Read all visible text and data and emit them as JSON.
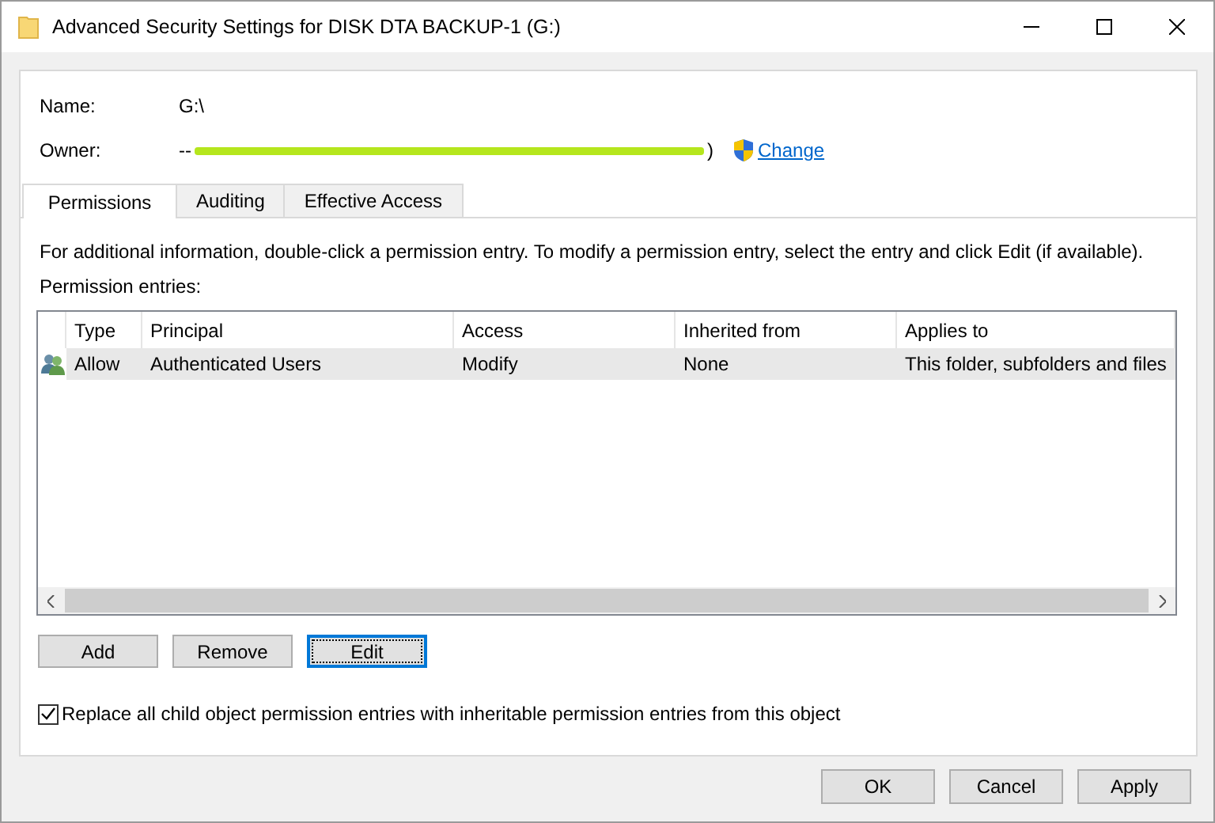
{
  "window": {
    "title": "Advanced Security Settings for DISK DTA BACKUP-1 (G:)"
  },
  "name": {
    "label": "Name:",
    "value": "G:\\"
  },
  "owner": {
    "label": "Owner:",
    "prefix": "--",
    "suffix": ")",
    "link": "Change"
  },
  "tabs": [
    {
      "label": "Permissions",
      "selected": true
    },
    {
      "label": "Auditing",
      "selected": false
    },
    {
      "label": "Effective Access",
      "selected": false
    }
  ],
  "info": "For additional information, double-click a permission entry. To modify a permission entry, select the entry and click Edit (if available).",
  "entries_label": "Permission entries:",
  "table": {
    "columns": [
      "Type",
      "Principal",
      "Access",
      "Inherited from",
      "Applies to"
    ],
    "rows": [
      {
        "cells": [
          "Allow",
          "Authenticated Users",
          "Modify",
          "None",
          "This folder, subfolders and files"
        ],
        "selected": true
      }
    ]
  },
  "entry_buttons": [
    {
      "label": "Add",
      "focused": false
    },
    {
      "label": "Remove",
      "focused": false
    },
    {
      "label": "Edit",
      "focused": true
    }
  ],
  "replace_checkbox": {
    "label": "Replace all child object permission entries with inheritable permission entries from this object",
    "checked": true
  },
  "buttons": [
    "OK",
    "Cancel",
    "Apply"
  ]
}
